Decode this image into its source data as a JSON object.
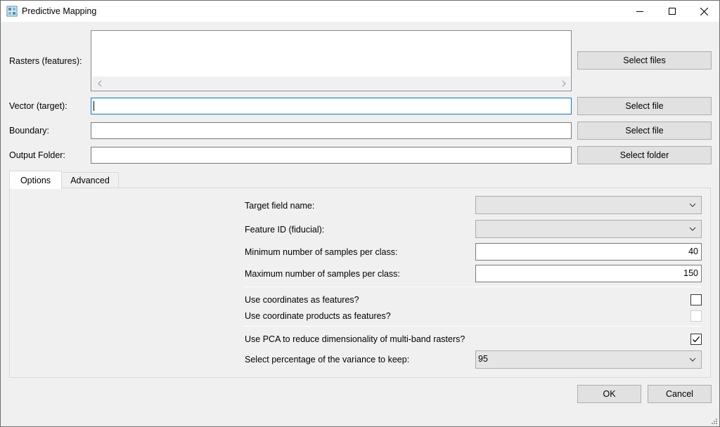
{
  "window": {
    "title": "Predictive Mapping",
    "app_icon": "grid-icon",
    "controls": [
      "minimize-icon",
      "maximize-icon",
      "close-icon"
    ]
  },
  "inputs": {
    "rasters_label": "Rasters (features):",
    "rasters_button": "Select files",
    "vector_label": "Vector (target):",
    "vector_value": "",
    "vector_button": "Select file",
    "boundary_label": "Boundary:",
    "boundary_value": "",
    "boundary_button": "Select file",
    "output_label": "Output Folder:",
    "output_value": "",
    "output_button": "Select folder"
  },
  "tabs": [
    {
      "label": "Options",
      "active": true
    },
    {
      "label": "Advanced",
      "active": false
    }
  ],
  "options": {
    "target_field_label": "Target field name:",
    "target_field_value": "",
    "feature_id_label": "Feature ID (fiducial):",
    "feature_id_value": "",
    "min_samples_label": "Minimum number of samples per class:",
    "min_samples_value": "40",
    "max_samples_label": "Maximum number of samples per class:",
    "max_samples_value": "150",
    "use_coords_label": "Use coordinates as features?",
    "use_coords_checked": false,
    "use_coord_products_label": "Use coordinate products as features?",
    "use_coord_products_checked": false,
    "use_coord_products_enabled": false,
    "use_pca_label": "Use PCA to reduce dimensionality of multi-band rasters?",
    "use_pca_checked": true,
    "variance_label": "Select percentage of the variance to keep:",
    "variance_value": "95"
  },
  "footer": {
    "ok_label": "OK",
    "cancel_label": "Cancel"
  },
  "colors": {
    "background": "#f0f0f0",
    "button": "#e1e1e1",
    "focus_border": "#0078d7"
  }
}
